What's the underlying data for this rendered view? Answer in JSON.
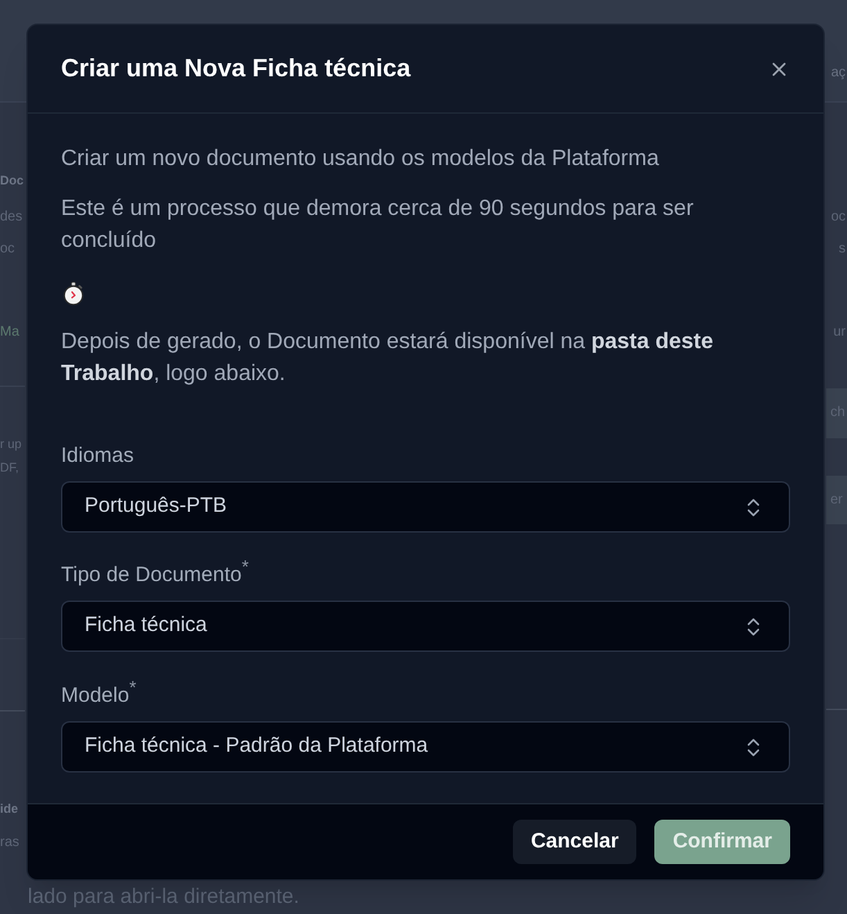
{
  "background_page": {
    "header_fragment": "aç",
    "left_fragments": [
      {
        "text": "Doc",
        "kind": "heading"
      },
      {
        "text": "des",
        "kind": "text"
      },
      {
        "text": "oc",
        "kind": "text"
      },
      {
        "text": "Ma",
        "kind": "link"
      },
      {
        "text": "r up",
        "kind": "small"
      },
      {
        "text": "DF,",
        "kind": "small"
      },
      {
        "text": "ide",
        "kind": "heading"
      },
      {
        "text": "ras",
        "kind": "text"
      }
    ],
    "right_fragments": [
      {
        "text": "oc",
        "kind": "text"
      },
      {
        "text": "s",
        "kind": "text"
      },
      {
        "text": "ur",
        "kind": "text"
      },
      {
        "text": "ch",
        "kind": "button"
      },
      {
        "text": "er",
        "kind": "button"
      }
    ],
    "footer_text": "lado para abri-la diretamente."
  },
  "dialog": {
    "title": "Criar uma Nova Ficha técnica",
    "paragraphs": [
      "Criar um novo documento usando os modelos da Plataforma",
      "Este é um processo que demora cerca de 90 segundos para ser concluído",
      "Depois de gerado, o Documento estará disponível na **pasta deste Trabalho**, logo abaixo."
    ],
    "fields": [
      {
        "label": "Idiomas",
        "value": "Português-PTB"
      },
      {
        "label": "Tipo de Documento$^{*}$",
        "value": "Ficha técnica"
      },
      {
        "label": "Modelo$^{*}$",
        "value": "Ficha técnica - Padrão da Plataforma"
      }
    ],
    "buttons": [
      {
        "label": "Cancelar",
        "kind": "secondary"
      },
      {
        "label": "Confirmar",
        "kind": "primary"
      }
    ]
  }
}
